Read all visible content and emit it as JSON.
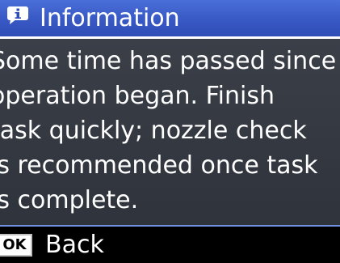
{
  "header": {
    "icon": "info-icon",
    "title": "Information",
    "color": "#3858c4"
  },
  "message": {
    "text": "Some time has passed since\noperation began. Finish\ntask quickly; nozzle check\nis recommended once task\nis complete."
  },
  "footer": {
    "ok_label": "OK",
    "back_label": "Back"
  }
}
